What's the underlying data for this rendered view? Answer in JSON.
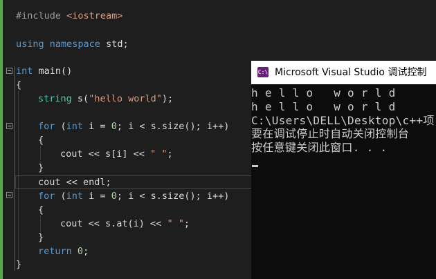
{
  "editor": {
    "lines": {
      "l1": {
        "pp": "#include ",
        "str": "<iostream>"
      },
      "l2": {
        "kw1": "using",
        "kw2": "namespace",
        "rest": " std;"
      },
      "l3": {
        "kw": "int",
        "fn": " main",
        "rest": "()"
      },
      "l4": {
        "text": "{"
      },
      "l5": {
        "ty": "string",
        "fn": " s",
        "p1": "(",
        "str": "\"hello world\"",
        "p2": ");"
      },
      "l6": {
        "kw1": "for",
        "p1": " (",
        "kw2": "int",
        "p2": " i = ",
        "num": "0",
        "p3": "; i < ",
        "fn": "s.size",
        "p4": "(); i++)"
      },
      "l7": {
        "text": "{"
      },
      "l8": {
        "p1": "cout << ",
        "fn": "s",
        "p2": "[i] << ",
        "str": "\" \"",
        "p3": ";"
      },
      "l9": {
        "text": "}"
      },
      "l10": {
        "p1": "cout << ",
        "fn": "endl",
        "p2": ";"
      },
      "l11": {
        "kw1": "for",
        "p1": " (",
        "kw2": "int",
        "p2": " i = ",
        "num": "0",
        "p3": "; i < ",
        "fn": "s.size",
        "p4": "(); i++)"
      },
      "l12": {
        "text": "{"
      },
      "l13": {
        "p1": "cout << ",
        "fn": "s.at",
        "p2": "(i) << ",
        "str": "\" \"",
        "p3": ";"
      },
      "l14": {
        "text": "}"
      },
      "l15": {
        "kw": "return",
        "rest": " ",
        "num": "0",
        "end": ";"
      },
      "l16": {
        "text": "}"
      }
    },
    "colors": {
      "background": "#1e1e1e",
      "keyword": "#569cd6",
      "type": "#4ec9b0",
      "string": "#d69d85",
      "number": "#b5cea8",
      "changes_bar": "#57a64a"
    }
  },
  "console": {
    "title": "Microsoft Visual Studio 调试控制",
    "icon": "visual-studio-icon",
    "lines": [
      "h e l l o   w o r l d",
      "h e l l o   w o r l d",
      "C:\\Users\\DELL\\Desktop\\c++项",
      "要在调试停止时自动关闭控制台",
      "按任意键关闭此窗口. . ."
    ]
  }
}
